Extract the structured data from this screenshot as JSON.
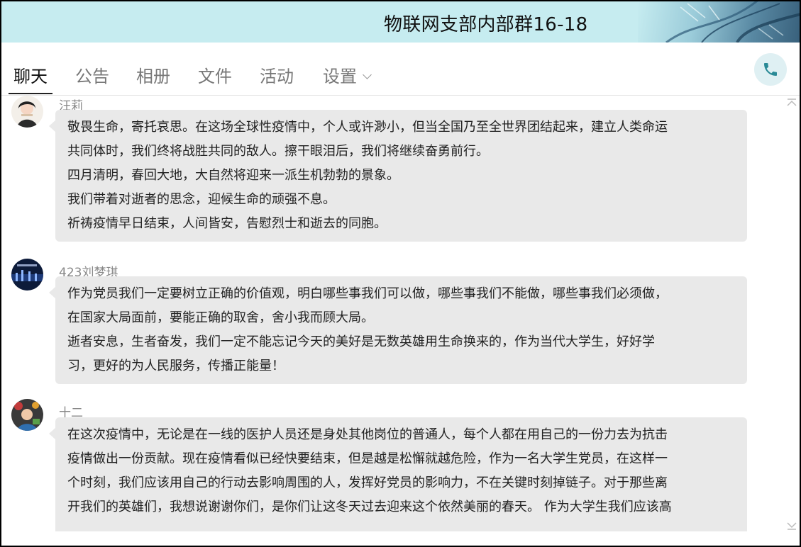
{
  "window": {
    "title": "物联网支部内部群16-18"
  },
  "tabs": [
    {
      "label": "聊天",
      "active": true
    },
    {
      "label": "公告",
      "active": false
    },
    {
      "label": "相册",
      "active": false
    },
    {
      "label": "文件",
      "active": false
    },
    {
      "label": "活动",
      "active": false
    },
    {
      "label": "设置",
      "active": false
    }
  ],
  "icons": {
    "call": "phone-icon",
    "settings_dropdown": "chevron-down-icon",
    "scroll_up": "chevron-up-icon",
    "scroll_down": "chevron-down-icon"
  },
  "colors": {
    "title_bar_bg": "#c6ecf0",
    "bubble_bg": "#e9e9e9",
    "call_icon": "#2a8a96"
  },
  "messages": [
    {
      "sender": "汪莉",
      "lines": [
        "敬畏生命，寄托哀思。在这场全球性疫情中，个人或许渺小，但当全国乃至全世界团结起来，建立人类命运",
        "共同体时，我们终将战胜共同的敌人。擦干眼泪后，我们将继续奋勇前行。",
        "四月清明，春回大地，大自然将迎来一派生机勃勃的景象。",
        "我们带着对逝者的思念，迎候生命的顽强不息。",
        "祈祷疫情早日结束，人间皆安，告慰烈士和逝去的同胞。"
      ]
    },
    {
      "sender": "423刘梦琪",
      "lines": [
        "作为党员我们一定要树立正确的价值观，明白哪些事我们可以做，哪些事我们不能做，哪些事我们必须做，",
        "在国家大局面前，要能正确的取舍，舍小我而顾大局。",
        "逝者安息，生者奋发，我们一定不能忘记今天的美好是无数英雄用生命换来的，作为当代大学生，好好学",
        "习，更好的为人民服务，传播正能量！"
      ]
    },
    {
      "sender": "十二",
      "lines": [
        "在这次疫情中，无论是在一线的医护人员还是身处其他岗位的普通人，每个人都在用自己的一份力去为抗击",
        "疫情做出一份贡献。现在疫情看似已经快要结束，但是越是松懈就越危险，作为一名大学生党员，在这样一",
        "个时刻，我们应该用自己的行动去影响周围的人，发挥好党员的影响力，不在关键时刻掉链子。对于那些离",
        "开我们的英雄们，我想说谢谢你们，是你们让这冬天过去迎来这个依然美丽的春天。 作为大学生我们应该高"
      ]
    }
  ]
}
